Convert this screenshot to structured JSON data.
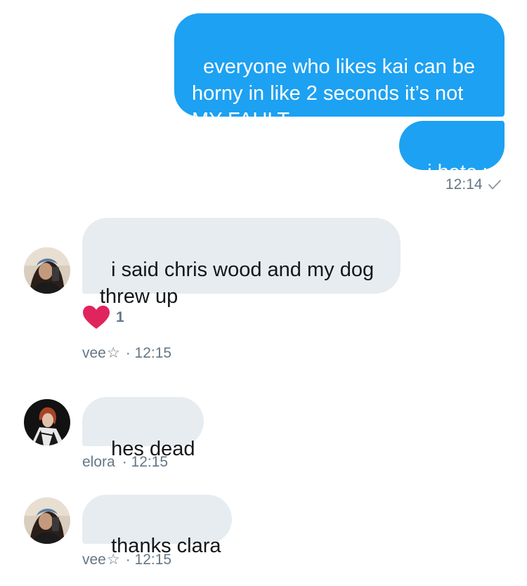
{
  "messages": [
    {
      "sender": "me",
      "text": "everyone who likes kai can be horny in like 2 seconds it’s not MY FAULT"
    },
    {
      "sender": "me",
      "text": "i hate u",
      "time": "12:14",
      "status_icon": "check-icon"
    },
    {
      "sender": "vee☆",
      "text": "i said chris wood and my dog threw up",
      "reaction": {
        "icon": "heart-icon",
        "count": "1",
        "color": "#e0245e"
      },
      "name": "vee",
      "star": "☆",
      "time": "· 12:15"
    },
    {
      "sender": "elora",
      "text": "hes dead",
      "name": "elora",
      "time": "· 12:15"
    },
    {
      "sender": "vee☆",
      "text": "thanks clara",
      "name": "vee",
      "star": "☆",
      "time": "· 12:15"
    }
  ],
  "colors": {
    "sent_bubble": "#1da1f2",
    "received_bubble": "#e6ecf0",
    "meta_text": "#657786"
  }
}
